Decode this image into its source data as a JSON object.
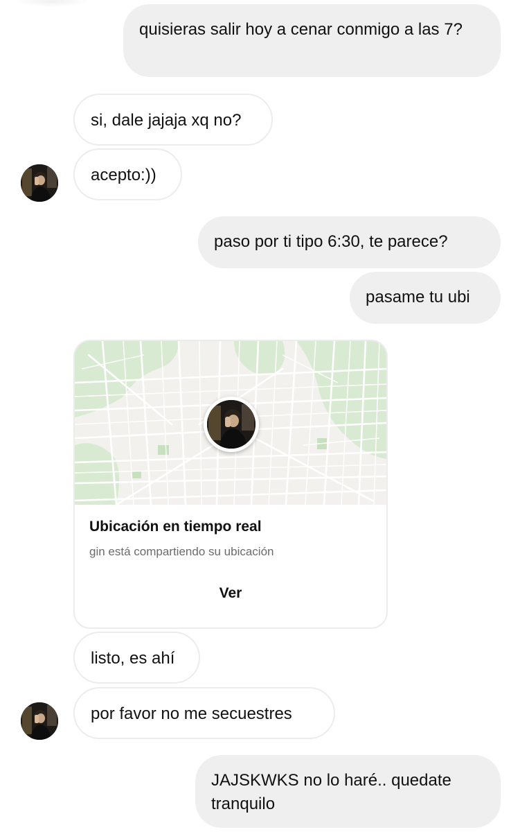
{
  "conversation": {
    "messages": [
      {
        "sender": "me",
        "text": "quisieras salir hoy a cenar conmigo a las 7?"
      },
      {
        "sender": "contact",
        "text": "si, dale jajaja xq no?"
      },
      {
        "sender": "contact",
        "text": "acepto:))"
      },
      {
        "sender": "me",
        "text": "paso por ti tipo 6:30, te parece?"
      },
      {
        "sender": "me",
        "text": "pasame tu ubi"
      },
      {
        "sender": "contact",
        "text": "listo, es ahí"
      },
      {
        "sender": "contact",
        "text": "por favor no me secuestres"
      },
      {
        "sender": "me",
        "text": "JAJSKWKS no lo haré.. quedate tranquilo"
      }
    ],
    "location_card": {
      "title": "Ubicación en tiempo real",
      "subtitle": "gin está compartiendo su ubicación",
      "action_label": "Ver",
      "map_icon": "map-icon",
      "pin_icon": "avatar-pin-icon"
    }
  },
  "colors": {
    "sent_bubble": "#efefef",
    "received_border": "#ececec",
    "map_green": "#d9ead2",
    "map_land": "#f2f1ee"
  }
}
